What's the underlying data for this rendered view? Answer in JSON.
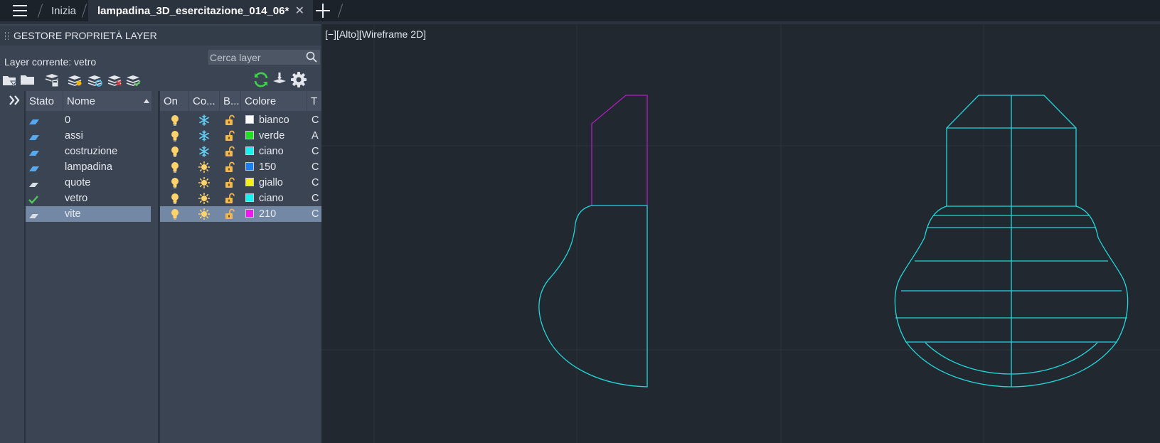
{
  "tabs": {
    "start_label": "Inizia",
    "active_label": "lampadina_3D_esercitazione_014_06*",
    "close_symbol": "✕"
  },
  "palette": {
    "title": "GESTORE PROPRIETÀ LAYER",
    "current_layer": "Layer corrente: vetro",
    "search_placeholder": "Cerca layer",
    "toolbar_icons": [
      "new-layer-filter-icon",
      "group-filter-icon",
      "layer-states-icon",
      "new-layer-icon",
      "new-layer-vp-frozen-icon",
      "delete-layer-icon",
      "set-current-icon",
      "refresh-icon",
      "layer-tool-icon",
      "settings-icon"
    ]
  },
  "columns": {
    "stato": "Stato",
    "nome": "Nome",
    "on": "On",
    "congela": "Co...",
    "blocca": "B...",
    "colore": "Colore",
    "tipo": "T"
  },
  "layers": [
    {
      "name": "0",
      "status": "layer",
      "color_name": "bianco",
      "color_hex": "#ffffff",
      "linetype_initial": "C",
      "frozen": true,
      "selected": false
    },
    {
      "name": "assi",
      "status": "layer",
      "color_name": "verde",
      "color_hex": "#1ee01e",
      "linetype_initial": "A",
      "frozen": true,
      "selected": false
    },
    {
      "name": "costruzione",
      "status": "layer",
      "color_name": "ciano",
      "color_hex": "#19f0f0",
      "linetype_initial": "C",
      "frozen": true,
      "selected": false
    },
    {
      "name": "lampadina",
      "status": "layer",
      "color_name": "150",
      "color_hex": "#1a7ff0",
      "linetype_initial": "C",
      "frozen": false,
      "selected": false
    },
    {
      "name": "quote",
      "status": "layer-empty",
      "color_name": "giallo",
      "color_hex": "#f5f01a",
      "linetype_initial": "C",
      "frozen": false,
      "selected": false
    },
    {
      "name": "vetro",
      "status": "current",
      "color_name": "ciano",
      "color_hex": "#19f0f0",
      "linetype_initial": "C",
      "frozen": false,
      "selected": false
    },
    {
      "name": "vite",
      "status": "layer-empty",
      "color_name": "210",
      "color_hex": "#ee19ee",
      "linetype_initial": "C",
      "frozen": false,
      "selected": true
    }
  ],
  "viewport": {
    "label": "[−][Alto][Wireframe 2D]",
    "cyan": "#22d8dc",
    "magenta": "#b21cc4",
    "grid_color": "#2c343e"
  }
}
